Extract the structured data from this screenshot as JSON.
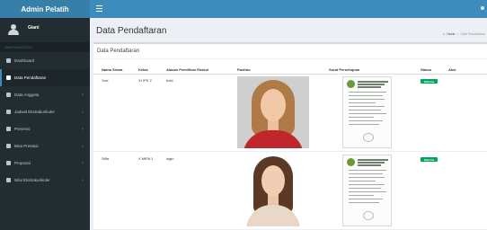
{
  "brand": {
    "title": "Admin Pelatih"
  },
  "user": {
    "name": "Giani"
  },
  "sidebar": {
    "header": "MAIN NAVIGATION",
    "items": [
      {
        "label": "Dashboard",
        "icon": "dashboard-icon",
        "has_children": false
      },
      {
        "label": "Data Pendaftaran",
        "icon": "book-icon",
        "has_children": false,
        "active": true
      },
      {
        "label": "Data Anggota",
        "icon": "table-icon",
        "has_children": true
      },
      {
        "label": "Jadwal Ekstrakurikuler",
        "icon": "calendar-icon",
        "has_children": true
      },
      {
        "label": "Presensi",
        "icon": "list-icon",
        "has_children": true
      },
      {
        "label": "Bina Prestasi",
        "icon": "edit-icon",
        "has_children": true
      },
      {
        "label": "Proposal",
        "icon": "edit-icon",
        "has_children": true
      },
      {
        "label": "Nilai Ekstrakurikuler",
        "icon": "edit-icon",
        "has_children": true
      }
    ]
  },
  "content": {
    "title": "Data Pendaftaran",
    "breadcrumb": {
      "home": "Home",
      "current": "Data Pendaftaran"
    }
  },
  "box": {
    "title": "Data Pendaftaran",
    "columns": [
      "Nama Siswa",
      "Kelas",
      "Alasan Pemilihan Ekskul",
      "Pasfoto",
      "Surat Persetujuan",
      "Status",
      "Aksi"
    ],
    "rows": [
      {
        "nama": "Yosi",
        "kelas": "XI IPS 2",
        "alasan": "hobi",
        "status": "Diterima"
      },
      {
        "nama": "Siffa",
        "kelas": "X MIPA 1",
        "alasan": "ingin",
        "status": "Diterima"
      }
    ]
  },
  "colors": {
    "header": "#3c8dbc",
    "brand_bg": "#367fa9",
    "sidebar": "#222d32",
    "status": "#00a65a"
  }
}
